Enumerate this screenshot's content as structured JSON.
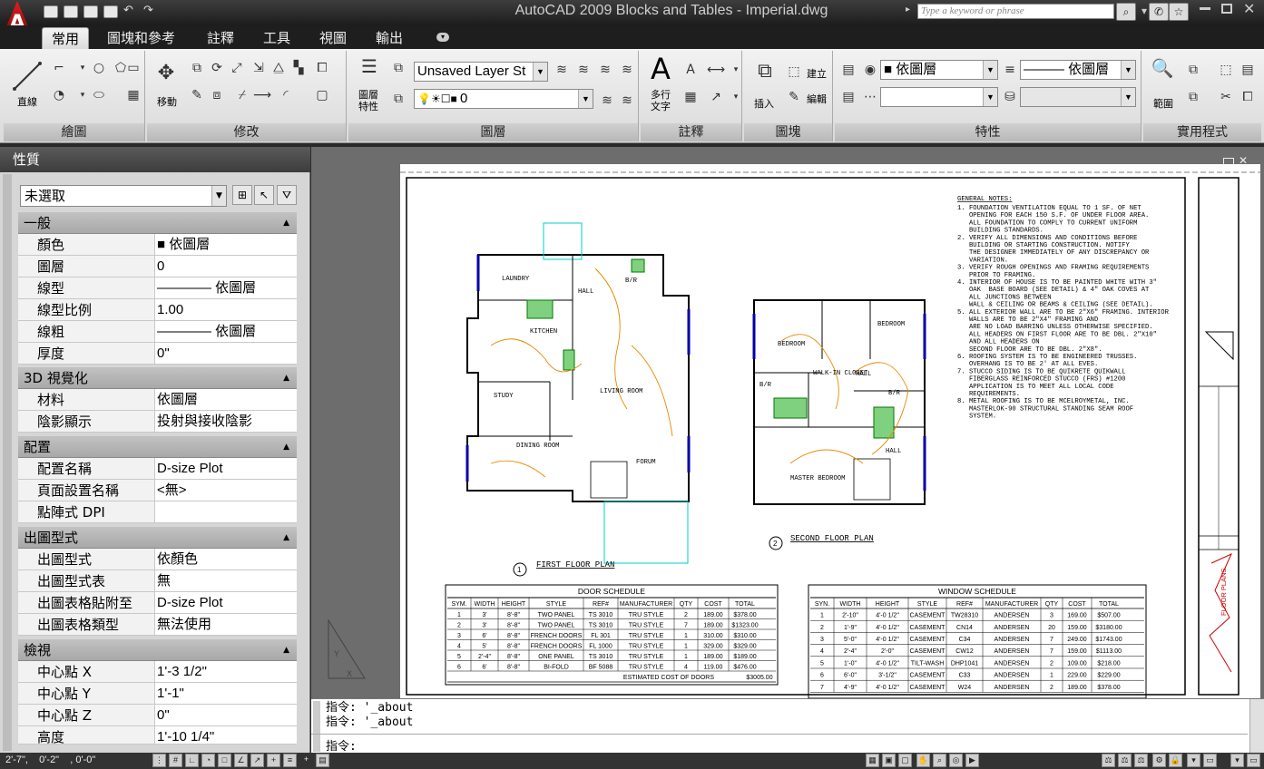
{
  "window": {
    "title": "AutoCAD 2009 Blocks and Tables - Imperial.dwg",
    "search_placeholder": "Type a keyword or phrase"
  },
  "ribbon_tabs": [
    {
      "label": "常用",
      "active": true
    },
    {
      "label": "圖塊和參考",
      "active": false
    },
    {
      "label": "註釋",
      "active": false
    },
    {
      "label": "工具",
      "active": false
    },
    {
      "label": "視圖",
      "active": false
    },
    {
      "label": "輸出",
      "active": false
    }
  ],
  "ribbon": {
    "draw": {
      "title": "繪圖",
      "line_label": "直線"
    },
    "modify": {
      "title": "修改",
      "move_label": "移動"
    },
    "layers": {
      "title": "圖層",
      "layer_props_label": "圖層\n特性",
      "layer_state": "Unsaved Layer St",
      "current_layer": "0"
    },
    "annotation": {
      "title": "註釋",
      "mtext_label": "多行\n文字"
    },
    "block": {
      "title": "圖塊",
      "insert_label": "插入",
      "create_label": "建立",
      "edit_label": "編輯"
    },
    "properties": {
      "title": "特性",
      "color": "依圖層",
      "linetype": "依圖層"
    },
    "utilities": {
      "title": "實用程式",
      "range_label": "範圍"
    }
  },
  "properties_palette": {
    "title": "性質",
    "selection": "未選取",
    "sections": [
      {
        "title": "一般",
        "rows": [
          {
            "key": "顏色",
            "value": "■ 依圖層"
          },
          {
            "key": "圖層",
            "value": "0"
          },
          {
            "key": "線型",
            "value": "———— 依圖層"
          },
          {
            "key": "線型比例",
            "value": "1.00"
          },
          {
            "key": "線粗",
            "value": "———— 依圖層"
          },
          {
            "key": "厚度",
            "value": "0\""
          }
        ]
      },
      {
        "title": "3D 視覺化",
        "rows": [
          {
            "key": "材料",
            "value": "依圖層"
          },
          {
            "key": "陰影顯示",
            "value": "投射與接收陰影"
          }
        ]
      },
      {
        "title": "配置",
        "rows": [
          {
            "key": "配置名稱",
            "value": "D-size Plot"
          },
          {
            "key": "頁面設置名稱",
            "value": "<無>"
          },
          {
            "key": "點陣式 DPI",
            "value": ""
          }
        ]
      },
      {
        "title": "出圖型式",
        "rows": [
          {
            "key": "出圖型式",
            "value": "依顏色"
          },
          {
            "key": "出圖型式表",
            "value": "無"
          },
          {
            "key": "出圖表格貼附至",
            "value": "D-size Plot"
          },
          {
            "key": "出圖表格類型",
            "value": "無法使用"
          }
        ]
      },
      {
        "title": "檢視",
        "rows": [
          {
            "key": "中心點 X",
            "value": "1'-3 1/2\""
          },
          {
            "key": "中心點 Y",
            "value": "1'-1\""
          },
          {
            "key": "中心點 Z",
            "value": "0\""
          },
          {
            "key": "高度",
            "value": "1'-10 1/4\""
          }
        ]
      }
    ]
  },
  "drawing": {
    "first_floor_label": "FIRST FLOOR PLAN",
    "second_floor_label": "SECOND FLOOR PLAN",
    "general_notes_title": "GENERAL NOTES:",
    "general_notes": [
      "1. FOUNDATION VENTILATION EQUAL TO 1 SF. OF NET",
      "   OPENING FOR EACH 150 S.F. OF UNDER FLOOR AREA.",
      "   ALL FOUNDATION TO COMPLY TO CURRENT UNIFORM",
      "   BUILDING STANDARDS.",
      "2. VERIFY ALL DIMENSIONS AND CONDITIONS BEFORE",
      "   BUILDING OR STARTING CONSTRUCTION. NOTIFY",
      "   THE DESIGNER IMMEDIATELY OF ANY DISCREPANCY OR",
      "   VARIATION.",
      "3. VERIFY ROUGH OPENINGS AND FRAMING REQUIREMENTS",
      "   PRIOR TO FRAMING.",
      "4. INTERIOR OF HOUSE IS TO BE PAINTED WHITE WITH 3\"",
      "   OAK  BASE BOARD (SEE DETAIL) & 4\" OAK COVES AT",
      "   ALL JUNCTIONS BETWEEN",
      "   WALL & CEILING OR BEAMS & CEILING (SEE DETAIL).",
      "5. ALL EXTERIOR WALL ARE TO BE 2\"X6\" FRAMING. INTERIOR",
      "   WALLS ARE TO BE 2\"X4\" FRAMING AND",
      "   ARE NO LOAD BARRING UNLESS OTHERWISE SPECIFIED.",
      "   ALL HEADERS ON FIRST FLOOR ARE TO BE DBL. 2\"X10\"",
      "   AND ALL HEADERS ON",
      "   SECOND FLOOR ARE TO BE DBL. 2\"X8\".",
      "6. ROOFING SYSTEM IS TO BE ENGINEERED TRUSSES.",
      "   OVERHANG IS TO BE 2' AT ALL EVES.",
      "7. STUCCO SIDING IS TO BE QUIKRETE QUIKWALL",
      "   FIBERGLASS REINFORCED STUCCO (FRS) #1200",
      "   APPLICATION IS TO MEET ALL LOCAL CODE",
      "   REQUIREMENTS.",
      "8. METAL ROOFING IS TO BE MCELROYMETAL, INC.",
      "   MASTERLOK-90 STRUCTURAL STANDING SEAM ROOF",
      "   SYSTEM."
    ],
    "first_floor_rooms": [
      "LAUNDRY",
      "HALL",
      "B/R",
      "KITCHEN",
      "LIVING ROOM",
      "STUDY",
      "DINING ROOM",
      "FORUM"
    ],
    "second_floor_rooms": [
      "BEDROOM",
      "BEDROOM",
      "WALK-IN CLOSET",
      "HALL",
      "B/R",
      "B/R",
      "HALL",
      "MASTER BEDROOM"
    ],
    "door_schedule": {
      "title": "DOOR SCHEDULE",
      "headers": [
        "SYM.",
        "WIDTH",
        "HEIGHT",
        "STYLE",
        "REF#",
        "MANUFACTURER",
        "QTY",
        "COST",
        "TOTAL"
      ],
      "rows": [
        [
          "1",
          "3'",
          "8'-8\"",
          "TWO PANEL",
          "TS 3010",
          "TRU STYLE",
          "2",
          "189.00",
          "$378.00"
        ],
        [
          "2",
          "3'",
          "8'-8\"",
          "TWO PANEL",
          "TS 3010",
          "TRU STYLE",
          "7",
          "189.00",
          "$1323.00"
        ],
        [
          "3",
          "6'",
          "8'-8\"",
          "FRENCH DOORS",
          "FL 301",
          "TRU STYLE",
          "1",
          "310.00",
          "$310.00"
        ],
        [
          "4",
          "5'",
          "8'-8\"",
          "FRENCH DOORS",
          "FL 1000",
          "TRU STYLE",
          "1",
          "329.00",
          "$329.00"
        ],
        [
          "5",
          "2'-4\"",
          "8'-8\"",
          "ONE PANEL",
          "TS 3010",
          "TRU STYLE",
          "1",
          "189.00",
          "$189.00"
        ],
        [
          "6",
          "6'",
          "8'-8\"",
          "BI-FOLD",
          "BF 5088",
          "TRU STYLE",
          "4",
          "119.00",
          "$476.00"
        ]
      ],
      "footer_label": "ESTIMATED COST OF DOORS",
      "footer_total": "$3005.00"
    },
    "window_schedule": {
      "title": "WINDOW SCHEDULE",
      "headers": [
        "SYN.",
        "WIDTH",
        "HEIGHT",
        "STYLE",
        "REF#",
        "MANUFACTURER",
        "QTY",
        "COST",
        "TOTAL"
      ],
      "rows": [
        [
          "1",
          "2'-10\"",
          "4'-0 1/2\"",
          "CASEMENT",
          "TW28310",
          "ANDERSEN",
          "3",
          "169.00",
          "$507.00"
        ],
        [
          "2",
          "1'-9\"",
          "4'-0 1/2\"",
          "CASEMENT",
          "CN14",
          "ANDERSEN",
          "20",
          "159.00",
          "$3180.00"
        ],
        [
          "3",
          "5'-0\"",
          "4'-0 1/2\"",
          "CASEMENT",
          "C34",
          "ANDERSEN",
          "7",
          "249.00",
          "$1743.00"
        ],
        [
          "4",
          "2'-4\"",
          "2'-0\"",
          "CASEMENT",
          "CW12",
          "ANDERSEN",
          "7",
          "159.00",
          "$1113.00"
        ],
        [
          "5",
          "1'-0\"",
          "4'-0 1/2\"",
          "TILT-WASH",
          "DHP1041",
          "ANDERSEN",
          "2",
          "109.00",
          "$218.00"
        ],
        [
          "6",
          "6'-0\"",
          "3'-1/2\"",
          "CASEMENT",
          "C33",
          "ANDERSEN",
          "1",
          "229.00",
          "$229.00"
        ],
        [
          "7",
          "4'-9\"",
          "4'-0 1/2\"",
          "CASEMENT",
          "W24",
          "ANDERSEN",
          "2",
          "189.00",
          "$378.00"
        ]
      ]
    },
    "title_block_label": "FLOOR PLANS"
  },
  "command_line": {
    "history": [
      "指令: '_about",
      "指令: '_about"
    ],
    "prompt": "指令:"
  },
  "status_bar": {
    "coordinates": "2'-7\",    0'-2\"    , 0'-0\""
  }
}
